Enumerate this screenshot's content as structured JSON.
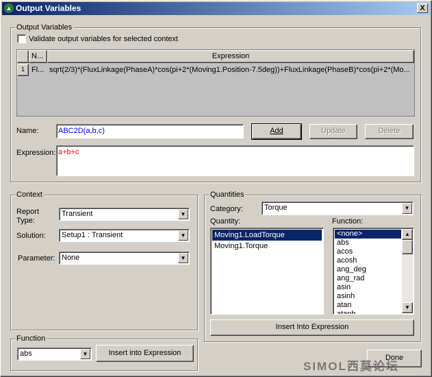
{
  "window": {
    "title": "Output Variables",
    "close": "X"
  },
  "output_variables": {
    "group_label": "Output Variables",
    "validate_label": "Validate output variables for selected context",
    "validate_checked": false,
    "table": {
      "headers": [
        "N...",
        "Expression"
      ],
      "rows": [
        {
          "index": "1",
          "name": "Fl...",
          "expression": "sqrt(2/3)*(FluxLinkage(PhaseA)*cos(pi+2*(Moving1.Position-7.5deg))+FluxLinkage(PhaseB)*cos(pi+2*(Mo..."
        }
      ]
    },
    "name_label": "Name:",
    "name_value": "ABC2D(a,b,c)",
    "add": "Add",
    "update": "Update",
    "delete": "Delete",
    "expression_label": "Expression:",
    "expression_value": "a+b+c"
  },
  "context": {
    "group_label": "Context",
    "report_type_label": "Report Type:",
    "report_type": "Transient",
    "solution_label": "Solution:",
    "solution": "Setup1 : Transient",
    "parameter_label": "Parameter:",
    "parameter": "None"
  },
  "function": {
    "group_label": "Function",
    "value": "abs",
    "insert": "Insert into Expression"
  },
  "quantities": {
    "group_label": "Quantities",
    "category_label": "Category:",
    "category": "Torque",
    "quantity_label": "Quantity:",
    "quantities": [
      "Moving1.LoadTorque",
      "Moving1.Torque"
    ],
    "selected_quantity": "Moving1.LoadTorque",
    "function_label": "Function:",
    "functions": [
      "<none>",
      "abs",
      "acos",
      "acosh",
      "ang_deg",
      "ang_rad",
      "asin",
      "asinh",
      "atan",
      "atanh"
    ],
    "selected_function": "<none>",
    "insert": "Insert Into Expression"
  },
  "done": "Done",
  "watermark": "SIMOL西莫论坛",
  "colors": {
    "titlebar_start": "#0a246a",
    "titlebar_end": "#a6caf0",
    "selection": "#0a246a",
    "name_text": "#0000ff",
    "expression_text": "#ff0000"
  }
}
